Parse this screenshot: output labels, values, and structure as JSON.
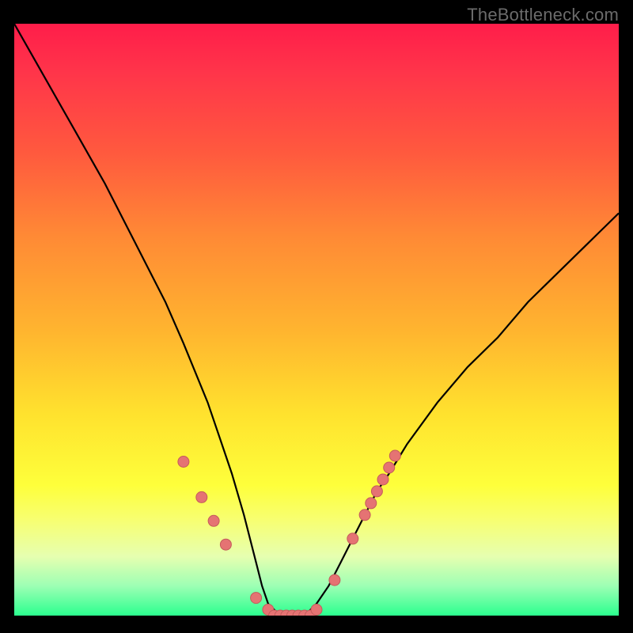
{
  "attribution": "TheBottleneck.com",
  "colors": {
    "background": "#000000",
    "gradient_top": "#ff1d4a",
    "gradient_mid_orange": "#ff8a35",
    "gradient_mid_yellow": "#ffe22e",
    "gradient_bottom": "#2bff8f",
    "curve_stroke": "#000000",
    "marker_fill": "#e57373",
    "marker_stroke": "#c45b5b",
    "attribution_text": "#6b6b6b"
  },
  "chart_data": {
    "type": "line",
    "title": "",
    "xlabel": "",
    "ylabel": "",
    "xlim": [
      0,
      100
    ],
    "ylim": [
      0,
      100
    ],
    "x": [
      0,
      5,
      10,
      15,
      20,
      25,
      28,
      30,
      32,
      34,
      36,
      38,
      40,
      41,
      42,
      43,
      44,
      45,
      46,
      47,
      48,
      49,
      50,
      52,
      54,
      56,
      58,
      60,
      62,
      65,
      70,
      75,
      80,
      85,
      90,
      95,
      100
    ],
    "values": [
      100,
      91,
      82,
      73,
      63,
      53,
      46,
      41,
      36,
      30,
      24,
      17,
      9,
      5,
      2,
      1,
      0,
      0,
      0,
      0,
      0,
      1,
      2,
      5,
      9,
      13,
      17,
      21,
      24,
      29,
      36,
      42,
      47,
      53,
      58,
      63,
      68
    ],
    "markers": [
      {
        "x": 28,
        "y": 26
      },
      {
        "x": 31,
        "y": 20
      },
      {
        "x": 33,
        "y": 16
      },
      {
        "x": 35,
        "y": 12
      },
      {
        "x": 40,
        "y": 3
      },
      {
        "x": 42,
        "y": 1
      },
      {
        "x": 43,
        "y": 0
      },
      {
        "x": 44,
        "y": 0
      },
      {
        "x": 45,
        "y": 0
      },
      {
        "x": 46,
        "y": 0
      },
      {
        "x": 47,
        "y": 0
      },
      {
        "x": 48,
        "y": 0
      },
      {
        "x": 49,
        "y": 0
      },
      {
        "x": 50,
        "y": 1
      },
      {
        "x": 53,
        "y": 6
      },
      {
        "x": 56,
        "y": 13
      },
      {
        "x": 58,
        "y": 17
      },
      {
        "x": 59,
        "y": 19
      },
      {
        "x": 60,
        "y": 21
      },
      {
        "x": 61,
        "y": 23
      },
      {
        "x": 62,
        "y": 25
      },
      {
        "x": 63,
        "y": 27
      }
    ]
  }
}
